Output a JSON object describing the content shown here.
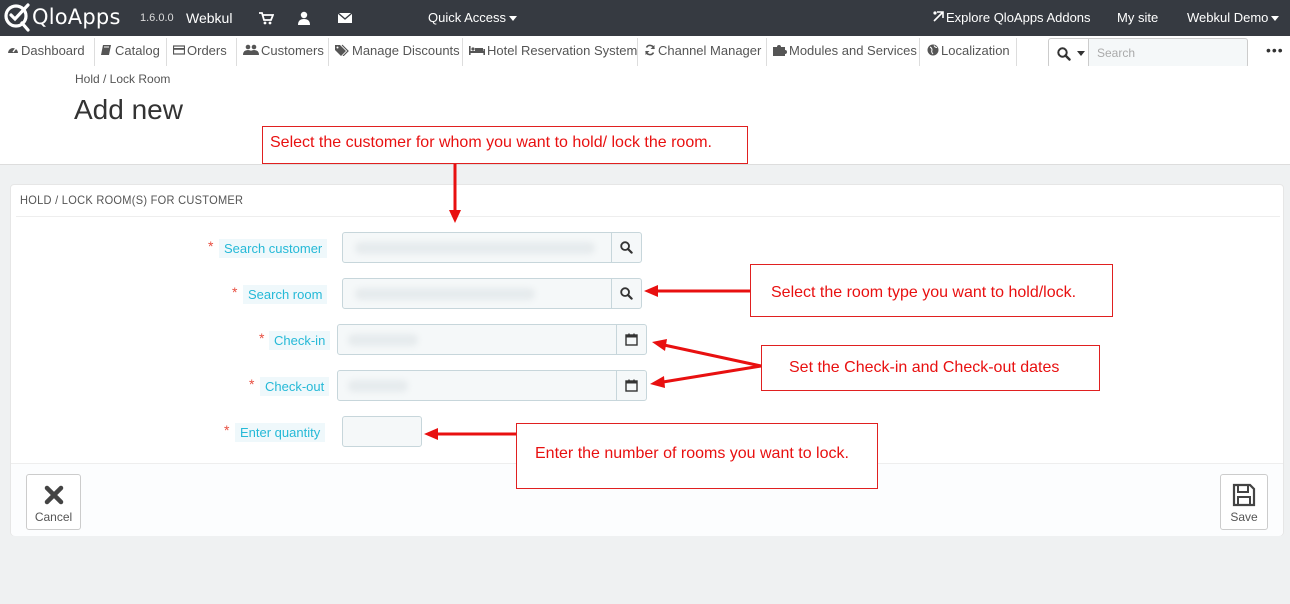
{
  "topbar": {
    "brand": "QloApps",
    "version": "1.6.0.0",
    "shop_name": "Webkul",
    "quick_access": "Quick Access",
    "explore": "Explore QloApps Addons",
    "my_site": "My site",
    "employee": "Webkul Demo"
  },
  "nav": {
    "items": [
      {
        "label": "Dashboard",
        "icon": "dashboard-icon"
      },
      {
        "label": "Catalog",
        "icon": "book-icon"
      },
      {
        "label": "Orders",
        "icon": "credit-card-icon"
      },
      {
        "label": "Customers",
        "icon": "users-icon"
      },
      {
        "label": "Manage Discounts",
        "icon": "tags-icon"
      },
      {
        "label": "Hotel Reservation System",
        "icon": "bed-icon"
      },
      {
        "label": "Channel Manager",
        "icon": "refresh-icon"
      },
      {
        "label": "Modules and Services",
        "icon": "puzzle-icon"
      },
      {
        "label": "Localization",
        "icon": "globe-icon"
      }
    ],
    "search_placeholder": "Search"
  },
  "header": {
    "breadcrumb": "Hold / Lock Room",
    "title": "Add new"
  },
  "panel": {
    "heading": "HOLD / LOCK ROOM(S) FOR CUSTOMER",
    "required_mark": "*",
    "fields": {
      "customer": "Search customer",
      "room": "Search room",
      "checkin": "Check-in",
      "checkout": "Check-out",
      "quantity": "Enter quantity"
    },
    "cancel_label": "Cancel",
    "save_label": "Save"
  },
  "annotations": {
    "customer": "Select the customer for whom you want to hold/ lock the room.",
    "room": "Select the room type you want to hold/lock.",
    "dates": "Set the Check-in and Check-out dates",
    "quantity": "Enter the number of rooms you want to lock."
  },
  "colors": {
    "topbar": "#363a41",
    "label": "#25b9d7",
    "required": "#e84e40",
    "annotation": "#e81010"
  }
}
